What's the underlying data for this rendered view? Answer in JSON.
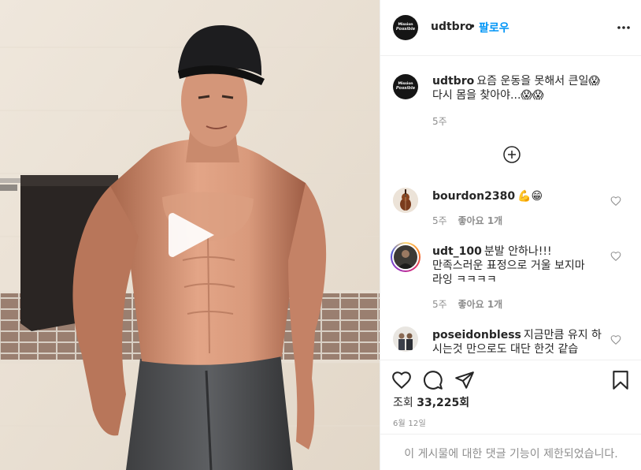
{
  "post": {
    "author": {
      "username": "udtbro",
      "avatar_line1": "Mission",
      "avatar_line2": "Possible"
    },
    "header": {
      "dot": "•",
      "follow_label": "팔로우",
      "more_icon": "more-horizontal-icon"
    },
    "media": {
      "type": "video",
      "play_icon": "play-icon"
    },
    "caption": {
      "username": "udtbro",
      "text_line1": "요즘 운동을 못해서 큰일😱",
      "text_line2": "다시 몸을 찾아야...😱😱",
      "time": "5주"
    },
    "load_more_icon": "plus-circle-icon",
    "comments": [
      {
        "username": "bourdon2380",
        "text": "💪😁",
        "time": "5주",
        "likes": "좋아요 1개",
        "avatar": "cello-avatar",
        "story_ring": false
      },
      {
        "username": "udt_100",
        "text_line1": "분발 안하나!!!",
        "text_line2": "만족스러운 표정으로 거울 보지마",
        "text_line3": "라잉 ㅋㅋㅋㅋ",
        "time": "5주",
        "likes": "좋아요 1개",
        "avatar": "person-avatar",
        "story_ring": true
      },
      {
        "username": "poseidonbless",
        "text_line1": "지금만큼 유지 하",
        "text_line2": "시는것 만으로도 대단 한것 같습",
        "avatar": "group-avatar",
        "story_ring": false
      }
    ],
    "actions": {
      "like_icon": "heart-icon",
      "comment_icon": "comment-icon",
      "share_icon": "send-icon",
      "save_icon": "bookmark-icon"
    },
    "views": {
      "label": "조회",
      "count": "33,225회"
    },
    "date": "6월 12일",
    "comments_disabled": "이 게시물에 대한 댓글 기능이 제한되었습니다."
  }
}
